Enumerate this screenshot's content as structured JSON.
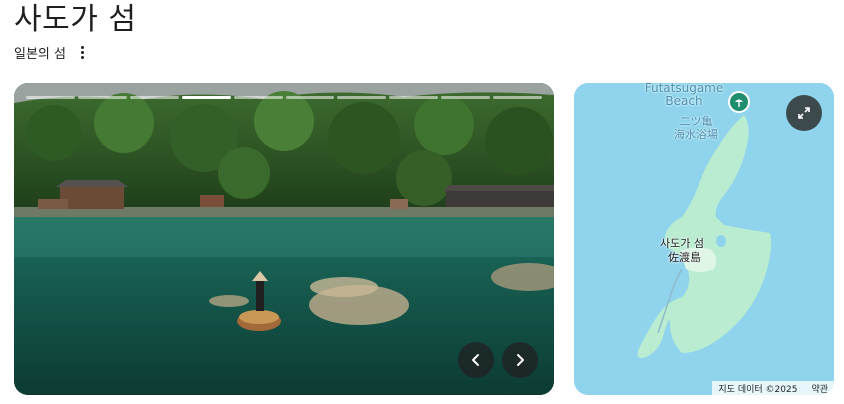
{
  "header": {
    "title": "사도가 섬",
    "subtitle": "일본의 섬"
  },
  "carousel": {
    "segments": 10,
    "active_segment": 3,
    "prev_icon": "chevron-left-icon",
    "next_icon": "chevron-right-icon"
  },
  "map": {
    "beach_name_en": "Futatsugame Beach",
    "beach_name_jp_top": "二ツ亀",
    "beach_name_jp_bottom": "海水浴場",
    "island_label_ko": "사도가 섬",
    "island_label_jp": "佐渡島",
    "attribution": "지도 데이터 ©2025",
    "terms": "약관",
    "pin_icon": "beach-umbrella-icon",
    "expand_icon": "expand-icon",
    "colors": {
      "water": "#8fd4ec",
      "land": "#b9ecd0",
      "pin": "#1e8e6e"
    }
  }
}
